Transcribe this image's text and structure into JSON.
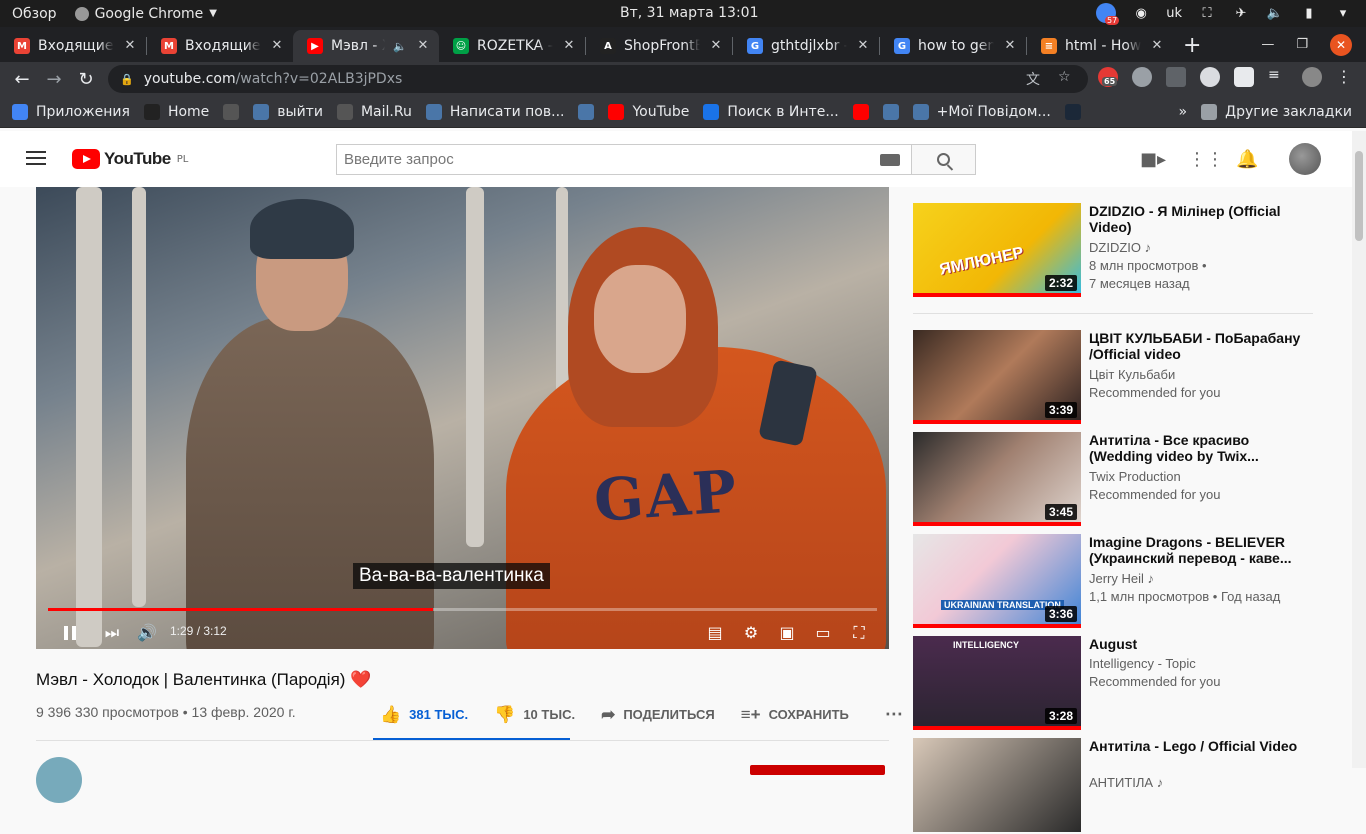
{
  "os": {
    "activities": "Обзор",
    "app": "Google Chrome",
    "datetime": "Вт, 31 марта  13:01",
    "lang": "uk",
    "badge": "57"
  },
  "tabs": [
    {
      "title": "Входящие (",
      "fav": "M",
      "favColor": "#ea4335"
    },
    {
      "title": "Входящие (",
      "fav": "M",
      "favColor": "#ea4335"
    },
    {
      "title": "Мэвл - Хо",
      "fav": "▶",
      "favColor": "#ff0000",
      "active": true
    },
    {
      "title": "ROZETKA —",
      "fav": "☺",
      "favColor": "#00a046"
    },
    {
      "title": "ShopFrontE",
      "fav": "A",
      "favColor": "#222222"
    },
    {
      "title": "gthtdjlxbr -",
      "fav": "G",
      "favColor": "#4285f4"
    },
    {
      "title": "how to gen",
      "fav": "G",
      "favColor": "#4285f4"
    },
    {
      "title": "html - How",
      "fav": "≡",
      "favColor": "#f48024"
    }
  ],
  "address": {
    "domain": "youtube.com",
    "path": "/watch?v=02ALB3jPDxs",
    "ext_badge": "65"
  },
  "bookmarks": [
    {
      "label": "Приложения",
      "color": "#4285f4",
      "icon": "apps-icon"
    },
    {
      "label": "Home",
      "color": "#222",
      "icon": "angular-icon"
    },
    {
      "label": "",
      "color": "#555",
      "icon": "globe-icon"
    },
    {
      "label": "выйти",
      "color": "#4a76a8",
      "icon": "vk-icon"
    },
    {
      "label": "Mail.Ru",
      "color": "#555",
      "icon": "globe-icon"
    },
    {
      "label": "Написати пов...",
      "color": "#4a76a8",
      "icon": "message-icon"
    },
    {
      "label": "",
      "color": "#4a76a8",
      "icon": "vk-icon"
    },
    {
      "label": "YouTube",
      "color": "#ff0000",
      "icon": "youtube-icon"
    },
    {
      "label": "Поиск в Инте...",
      "color": "#1a73e8",
      "icon": "search-icon"
    },
    {
      "label": "",
      "color": "#ff0000",
      "icon": "youtube-icon"
    },
    {
      "label": "",
      "color": "#4a76a8",
      "icon": "vk-icon"
    },
    {
      "label": "+Мої Повідом...",
      "color": "#4a76a8",
      "icon": "vk-icon"
    },
    {
      "label": "",
      "color": "#1b2838",
      "icon": "steam-icon"
    }
  ],
  "bookmarks_more": "»",
  "other_bookmarks": "Другие закладки",
  "yt": {
    "logo": "YouTube",
    "region": "PL",
    "search_placeholder": "Введите запрос"
  },
  "video": {
    "subtitle": "Ва-ва-ва-валентинка",
    "time": "1:29 / 3:12",
    "progress": 0.465,
    "title": "Мэвл - Холодок | Валентинка (Пародія) ❤️",
    "meta": "9 396 330 просмотров • 13 февр. 2020 г.",
    "likes": "381 ТЫС.",
    "dislikes": "10 ТЫС.",
    "share": "ПОДЕЛИТЬСЯ",
    "save": "СОХРАНИТЬ"
  },
  "recommendations": [
    {
      "title": "DZIDZIO - Я Мілінер (Official Video)",
      "channel": "DZIDZIO ♪",
      "line2": "8 млн просмотров •",
      "line3": "7 месяцев назад",
      "duration": "2:32",
      "thumb_text": "ЯМЛЮНЕР"
    },
    {
      "title": "ЦВІТ КУЛЬБАБИ - ПоБарабану /Official video",
      "channel": "Цвіт Кульбаби",
      "line2": "Recommended for you",
      "line3": "",
      "duration": "3:39",
      "thumb_text": ""
    },
    {
      "title": "Антитіла - Все красиво (Wedding video by Twix...",
      "channel": "Twix Production",
      "line2": "Recommended for you",
      "line3": "",
      "duration": "3:45",
      "thumb_text": ""
    },
    {
      "title": "Imagine Dragons - BELIEVER (Украинский перевод - каве...",
      "channel": "Jerry Heil ♪",
      "line2": "1,1 млн просмотров • Год назад",
      "line3": "",
      "duration": "3:36",
      "thumb_text": "UKRAINIAN TRANSLATION"
    },
    {
      "title": "August",
      "channel": "Intelligency - Topic",
      "line2": "Recommended for you",
      "line3": "",
      "duration": "3:28",
      "thumb_text": "INTELLIGENCY"
    },
    {
      "title": "Антитіла - Lego / Official Video",
      "channel": "АНТИТІЛА ♪",
      "line2": "",
      "line3": "",
      "duration": "",
      "thumb_text": ""
    }
  ]
}
